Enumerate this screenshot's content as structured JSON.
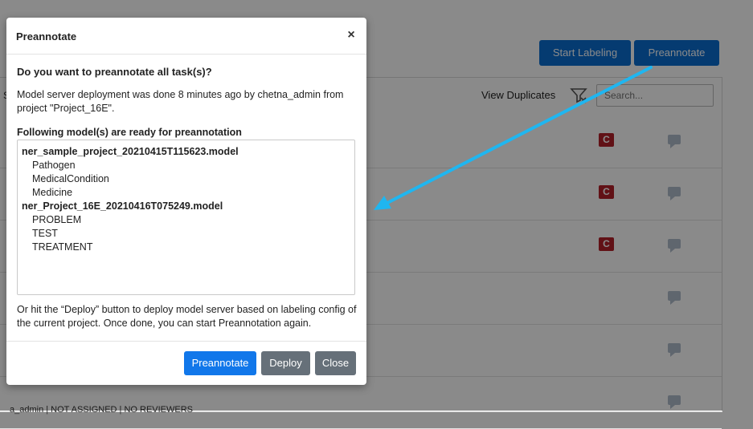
{
  "background": {
    "start_labeling_label": "Start Labeling",
    "preannotate_label": "Preannotate",
    "view_duplicates_label": "View Duplicates",
    "search_placeholder": "Search...",
    "left_column_fragment": "S",
    "row_badge": "C",
    "footer_text": "a_admin  |  NOT ASSIGNED  |  NO REVIEWERS"
  },
  "modal": {
    "title": "Preannotate",
    "close_icon": "×",
    "question": "Do you want to preannotate all task(s)?",
    "deploy_info": "Model server deployment was done 8 minutes ago by chetna_admin from project \"Project_16E\".",
    "models_heading": "Following model(s) are ready for preannotation",
    "models": [
      {
        "name": "ner_sample_project_20210415T115623.model",
        "labels": [
          "Pathogen",
          "MedicalCondition",
          "Medicine"
        ]
      },
      {
        "name": "ner_Project_16E_20210416T075249.model",
        "labels": [
          "PROBLEM",
          "TEST",
          "TREATMENT"
        ]
      }
    ],
    "deploy_hint": "Or hit the “Deploy” button to deploy model server based on labeling config of the current project. Once done, you can start Preannotation again.",
    "buttons": {
      "preannotate": "Preannotate",
      "deploy": "Deploy",
      "close": "Close"
    }
  },
  "colors": {
    "primary": "#1177ea",
    "secondary": "#667079",
    "badge": "#b3202a",
    "arrow": "#1fb6f0"
  }
}
